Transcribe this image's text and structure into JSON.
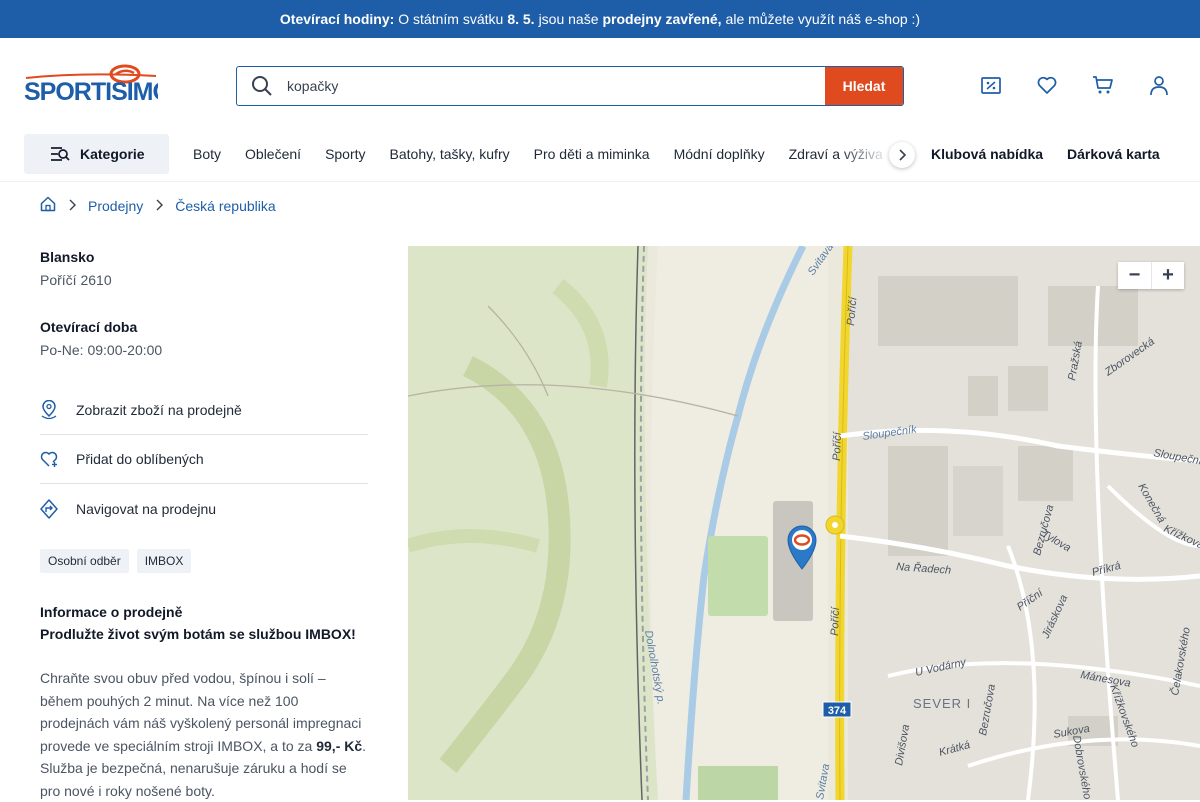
{
  "banner": {
    "part1_bold": "Otevírací hodiny:",
    "part2": "O státním svátku",
    "part3_bold": "8. 5.",
    "part4": "jsou naše",
    "part5_bold": "prodejny zavřené,",
    "part6": "ale můžete využít náš e-shop :)"
  },
  "header": {
    "logo_text": "SPORTISIMO",
    "search": {
      "value": "kopačky",
      "button_label": "Hledat"
    },
    "icons": [
      "discount-icon",
      "heart-icon",
      "cart-icon",
      "user-icon"
    ]
  },
  "nav": {
    "kategorie_label": "Kategorie",
    "items": [
      "Boty",
      "Oblečení",
      "Sporty",
      "Batohy, tašky, kufry",
      "Pro děti a miminka",
      "Módní doplňky",
      "Zdraví a výživa"
    ],
    "right_items": [
      "Klubová nabídka",
      "Dárková karta"
    ]
  },
  "breadcrumb": {
    "items": [
      "Prodejny",
      "Česká republika"
    ]
  },
  "store": {
    "city": "Blansko",
    "address": "Poříčí 2610",
    "hours_label": "Otevírací doba",
    "hours": "Po-Ne: 09:00-20:00",
    "actions": [
      "Zobrazit zboží na prodejně",
      "Přidat do oblíbených",
      "Navigovat na prodejnu"
    ],
    "tags": [
      "Osobní odběr",
      "IMBOX"
    ],
    "info_label": "Informace o prodejně",
    "info_headline": "Prodlužte život svým botám se službou IMBOX!",
    "info_text_1": "Chraňte svou obuv před vodou, špínou i solí – během pouhých 2 minut. Na více než 100 prodejnách vám náš vyškolený personál impregnaci provede ve speciálním stroji IMBOX, a to za",
    "info_price": "99,- Kč",
    "info_text_2": ". Služba je bezpečná, nenarušuje záruku a hodí se pro nové i roky nošené boty."
  },
  "map": {
    "zoom_out": "−",
    "zoom_in": "+",
    "labels": {
      "porici": "Poříčí",
      "svitava": "Svitava",
      "sloupecnik": "Sloupečník",
      "prazska": "Pražská",
      "zborovecka": "Zborovecká",
      "na_radech": "Na Řadech",
      "bezrucova": "Bezručova",
      "tylova": "Tylova",
      "prikra": "Příkrá",
      "konecna": "Konečná",
      "krizkova": "Křížkova",
      "pricni": "Příční",
      "jiraskova": "Jiráskova",
      "u_vodarny": "U Vodárny",
      "manesova": "Mánesova",
      "celakovskeho": "Čelakovského",
      "sever": "SEVER I",
      "divisova": "Divišova",
      "kratka": "Krátká",
      "sukova": "Sukova",
      "krizkovskeho": "Křížkovského",
      "dobrovskeho": "Dobrovského",
      "dolnolhotsky": "Dolnolhotský p.",
      "road_374": "374"
    }
  },
  "colors": {
    "brand_blue": "#1e5ea8",
    "accent_orange": "#e04a1f",
    "road_yellow": "#f2d630"
  }
}
